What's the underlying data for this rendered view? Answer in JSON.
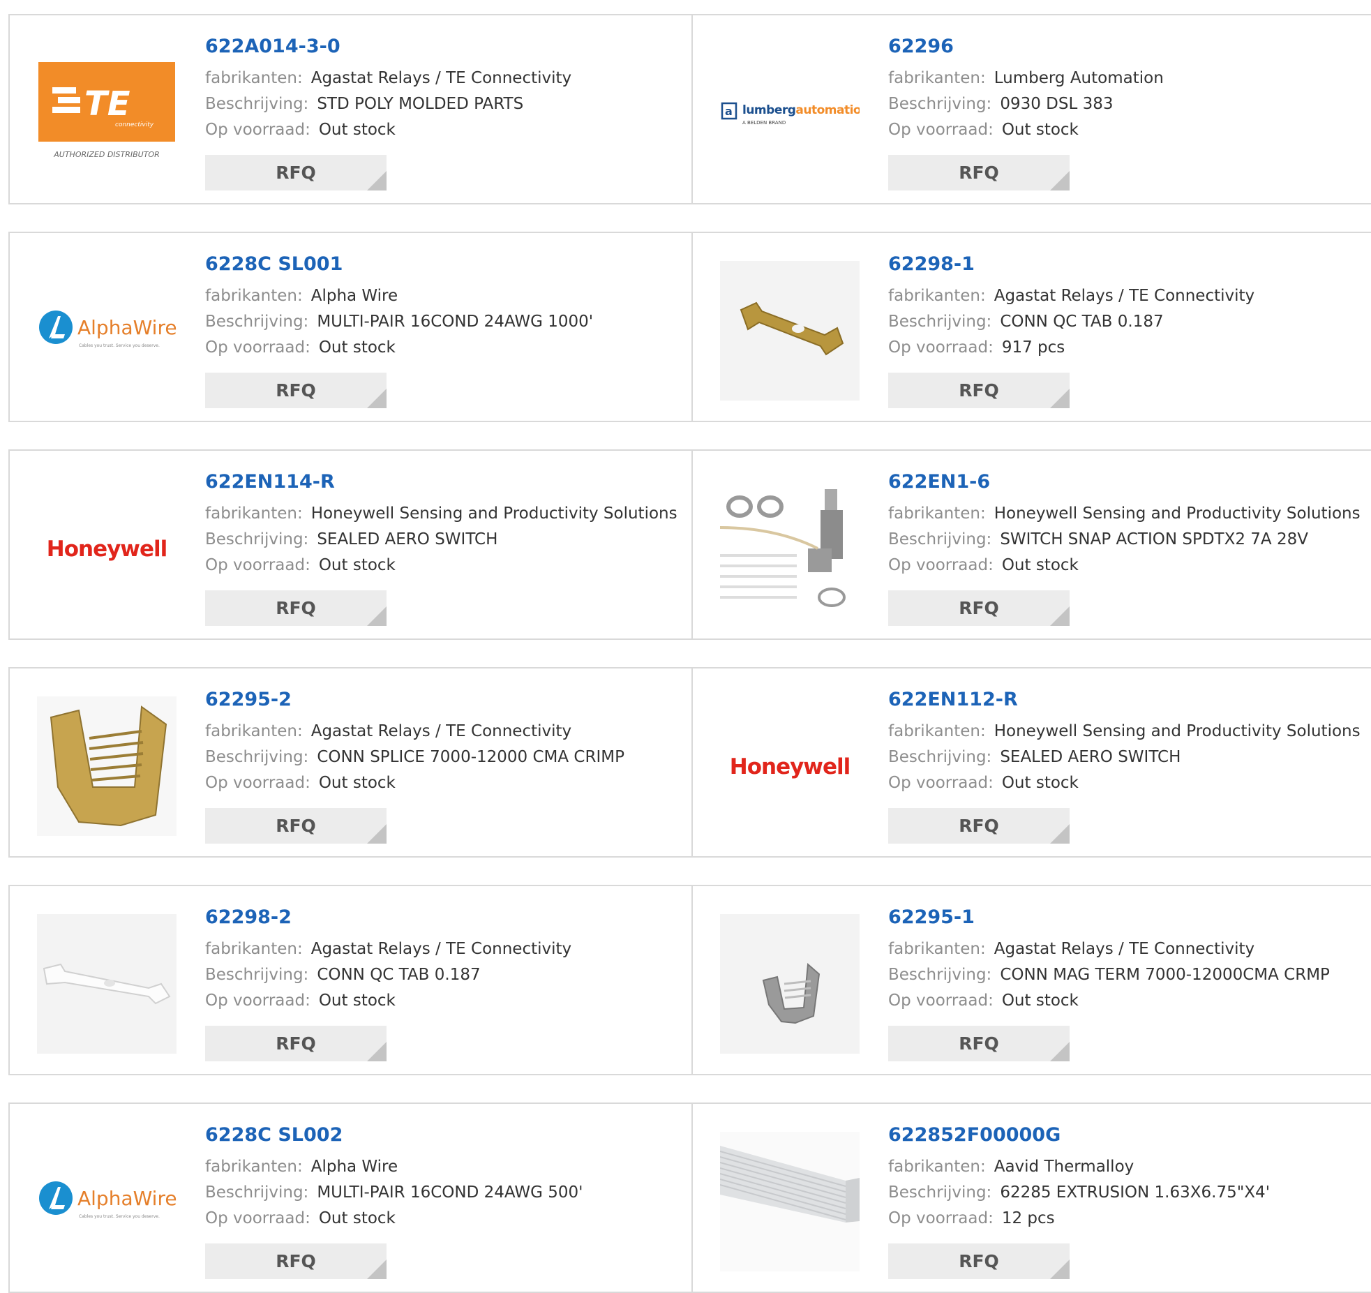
{
  "labels": {
    "manufacturer": "fabrikanten:",
    "description": "Beschrijving:",
    "stock": "Op voorraad:",
    "rfq": "RFQ"
  },
  "logos": {
    "te_authorized": "AUTHORIZED DISTRIBUTOR",
    "te_mark": "TE",
    "te_sub": "connectivity",
    "lumberg_a": "lumberg",
    "lumberg_b": "automation",
    "lumberg_sub": "A BELDEN BRAND",
    "alpha": "AlphaWire",
    "alpha_sub": "Cables you trust. Service you deserve.",
    "honeywell": "Honeywell"
  },
  "colors": {
    "link": "#1c63b7",
    "te_orange": "#f28c28",
    "honeywell_red": "#e1251b",
    "alpha_blue": "#1a8fd0"
  },
  "products": [
    {
      "pn": "622A014-3-0",
      "manufacturer": "Agastat Relays / TE Connectivity",
      "description": "STD POLY MOLDED PARTS",
      "stock": "Out stock",
      "image": "te-logo"
    },
    {
      "pn": "62296",
      "manufacturer": "Lumberg Automation",
      "description": "0930 DSL 383",
      "stock": "Out stock",
      "image": "lumberg-logo"
    },
    {
      "pn": "6228C SL001",
      "manufacturer": "Alpha Wire",
      "description": "MULTI-PAIR 16COND 24AWG 1000'",
      "stock": "Out stock",
      "image": "alphawire-logo"
    },
    {
      "pn": "62298-1",
      "manufacturer": "Agastat Relays / TE Connectivity",
      "description": "CONN QC TAB 0.187",
      "stock": "917 pcs",
      "image": "brass-tab-photo"
    },
    {
      "pn": "622EN114-R",
      "manufacturer": "Honeywell Sensing and Productivity Solutions",
      "description": "SEALED AERO SWITCH",
      "stock": "Out stock",
      "image": "honeywell-logo"
    },
    {
      "pn": "622EN1-6",
      "manufacturer": "Honeywell Sensing and Productivity Solutions",
      "description": "SWITCH SNAP ACTION SPDTX2 7A 28V",
      "stock": "Out stock",
      "image": "switch-photo"
    },
    {
      "pn": "62295-2",
      "manufacturer": "Agastat Relays / TE Connectivity",
      "description": "CONN SPLICE 7000-12000 CMA CRIMP",
      "stock": "Out stock",
      "image": "brass-splice-photo"
    },
    {
      "pn": "622EN112-R",
      "manufacturer": "Honeywell Sensing and Productivity Solutions",
      "description": "SEALED AERO SWITCH",
      "stock": "Out stock",
      "image": "honeywell-logo"
    },
    {
      "pn": "62298-2",
      "manufacturer": "Agastat Relays / TE Connectivity",
      "description": "CONN QC TAB 0.187",
      "stock": "Out stock",
      "image": "white-tab-photo"
    },
    {
      "pn": "62295-1",
      "manufacturer": "Agastat Relays / TE Connectivity",
      "description": "CONN MAG TERM 7000-12000CMA CRMP",
      "stock": "Out stock",
      "image": "grey-splice-photo"
    },
    {
      "pn": "6228C SL002",
      "manufacturer": "Alpha Wire",
      "description": "MULTI-PAIR 16COND 24AWG 500'",
      "stock": "Out stock",
      "image": "alphawire-logo"
    },
    {
      "pn": "622852F00000G",
      "manufacturer": "Aavid Thermalloy",
      "description": "62285 EXTRUSION 1.63X6.75\"X4'",
      "stock": "12 pcs",
      "image": "extrusion-photo"
    }
  ]
}
